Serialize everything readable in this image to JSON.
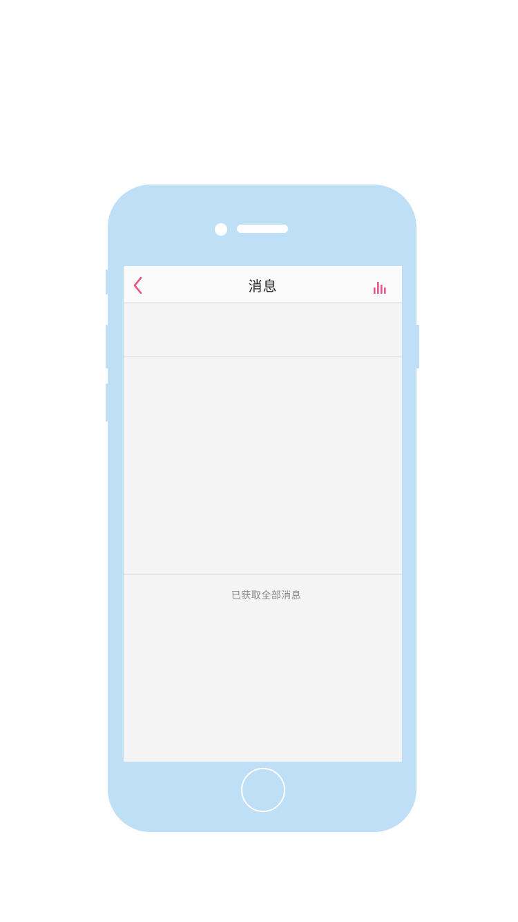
{
  "header": {
    "title": "消息",
    "back_icon": "chevron-left-icon",
    "right_icon": "bar-chart-icon"
  },
  "status": {
    "all_loaded_text": "已获取全部消息"
  },
  "colors": {
    "accent": "#e8558a",
    "phone_body": "#bedff6",
    "screen_bg": "#f4f4f4",
    "nav_bg": "#fbfbfb",
    "divider": "#e6e6e6"
  }
}
